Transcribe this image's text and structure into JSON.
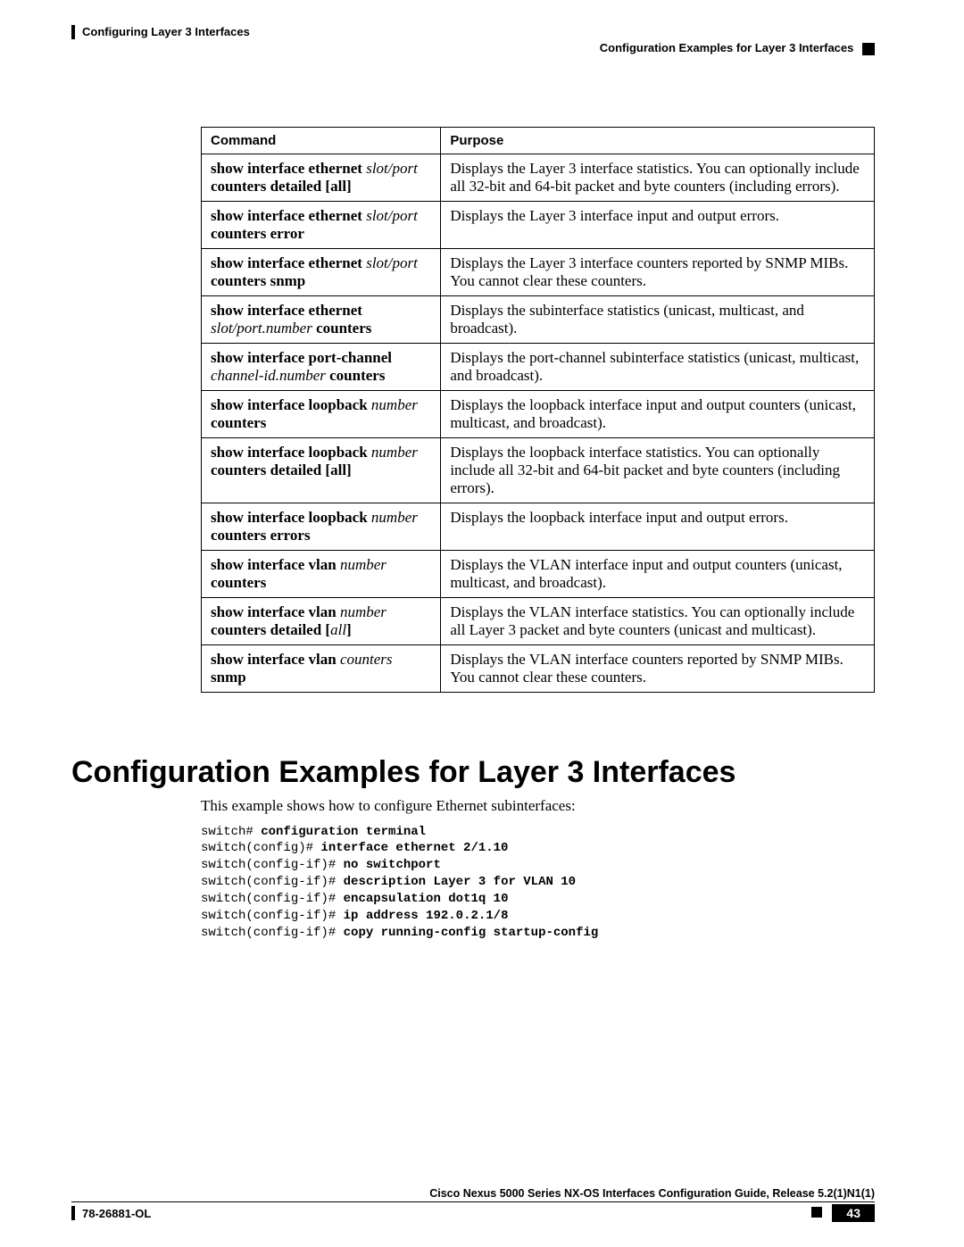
{
  "header": {
    "left": "Configuring Layer 3 Interfaces",
    "right": "Configuration Examples for Layer 3 Interfaces"
  },
  "table": {
    "head_cmd": "Command",
    "head_purpose": "Purpose",
    "rows": [
      {
        "cmd_pre": "show interface ethernet ",
        "cmd_ital": "slot/port",
        "cmd_post": " counters detailed [all]",
        "purpose": "Displays the Layer 3 interface statistics. You can optionally include all 32-bit and 64-bit packet and byte counters (including errors)."
      },
      {
        "cmd_pre": "show interface ethernet ",
        "cmd_ital": "slot/port",
        "cmd_post": " counters error",
        "purpose": "Displays the Layer 3 interface input and output errors."
      },
      {
        "cmd_pre": "show interface ethernet ",
        "cmd_ital": "slot/port",
        "cmd_post": " counters snmp",
        "purpose": "Displays the Layer 3 interface counters reported by SNMP MIBs. You cannot clear these counters."
      },
      {
        "cmd_pre": "show interface ethernet ",
        "cmd_ital": "slot/port.number",
        "cmd_post": " counters",
        "purpose": "Displays the subinterface statistics (unicast, multicast, and broadcast)."
      },
      {
        "cmd_pre": "show interface port-channel ",
        "cmd_ital": "channel-id.number",
        "cmd_post": " counters",
        "purpose": "Displays the port-channel subinterface statistics (unicast, multicast, and broadcast)."
      },
      {
        "cmd_pre": "show interface loopback ",
        "cmd_ital": "number",
        "cmd_post": " counters",
        "purpose": "Displays the loopback interface input and output counters (unicast, multicast, and broadcast)."
      },
      {
        "cmd_pre": "show interface loopback ",
        "cmd_ital": "number",
        "cmd_post": " counters detailed [all]",
        "purpose": "Displays the loopback interface statistics. You can optionally include all 32-bit and 64-bit packet and byte counters (including errors)."
      },
      {
        "cmd_pre": "show interface loopback ",
        "cmd_ital": "number",
        "cmd_post": " counters errors",
        "purpose": "Displays the loopback interface input and output errors."
      },
      {
        "cmd_pre": "show interface vlan ",
        "cmd_ital": "number",
        "cmd_post": " counters",
        "purpose": "Displays the VLAN interface input and output counters (unicast, multicast, and broadcast)."
      },
      {
        "cmd_pre": "show interface vlan ",
        "cmd_ital": "number",
        "cmd_post_mixed": " counters detailed [",
        "cmd_post_ital": "all",
        "cmd_post_end": "]",
        "purpose": "Displays the VLAN interface statistics. You can optionally include all Layer 3 packet and byte counters (unicast and multicast)."
      },
      {
        "cmd_pre": "show interface vlan ",
        "cmd_ital": "counters",
        "cmd_post": " snmp",
        "purpose": "Displays the VLAN interface counters reported by SNMP MIBs. You cannot clear these counters."
      }
    ]
  },
  "section": {
    "title": "Configuration Examples for Layer 3 Interfaces",
    "intro": "This example shows how to configure Ethernet subinterfaces:",
    "code": [
      {
        "p": "switch# ",
        "b": "configuration terminal"
      },
      {
        "p": "switch(config)# ",
        "b": "interface ethernet 2/1.10"
      },
      {
        "p": "switch(config-if)# ",
        "b": "no switchport"
      },
      {
        "p": "switch(config-if)# ",
        "b": "description Layer 3 for VLAN 10"
      },
      {
        "p": "switch(config-if)# ",
        "b": "encapsulation dot1q 10"
      },
      {
        "p": "switch(config-if)# ",
        "b": "ip address 192.0.2.1/8"
      },
      {
        "p": "switch(config-if)# ",
        "b": "copy running-config startup-config"
      }
    ]
  },
  "footer": {
    "title": "Cisco Nexus 5000 Series NX-OS Interfaces Configuration Guide, Release 5.2(1)N1(1)",
    "doc": "78-26881-OL",
    "page": "43"
  }
}
